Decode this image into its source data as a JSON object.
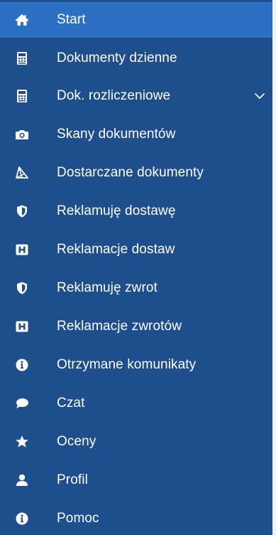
{
  "sidebar": {
    "items": [
      {
        "label": "Start",
        "icon": "home-icon",
        "active": true
      },
      {
        "label": "Dokumenty dzienne",
        "icon": "calculator-icon"
      },
      {
        "label": "Dok. rozliczeniowe",
        "icon": "calculator-icon",
        "expandable": true
      },
      {
        "label": "Skany dokumentów",
        "icon": "camera-icon"
      },
      {
        "label": "Dostarczane dokumenty",
        "icon": "send-icon"
      },
      {
        "label": "Reklamuję dostawę",
        "icon": "shield-icon"
      },
      {
        "label": "Reklamacje dostaw",
        "icon": "h-square-icon"
      },
      {
        "label": "Reklamuję zwrot",
        "icon": "shield-icon"
      },
      {
        "label": "Reklamacje zwrotów",
        "icon": "h-square-icon"
      },
      {
        "label": "Otrzymane komunikaty",
        "icon": "info-circle-icon"
      },
      {
        "label": "Czat",
        "icon": "comment-icon"
      },
      {
        "label": "Oceny",
        "icon": "star-icon"
      },
      {
        "label": "Profil",
        "icon": "user-icon"
      },
      {
        "label": "Pomoc",
        "icon": "info-circle-icon"
      }
    ]
  },
  "colors": {
    "sidebar_bg": "#1e4e8c",
    "active_bg": "#2d6fc1",
    "text": "#ffffff",
    "page_bg": "#f2f2f2"
  }
}
